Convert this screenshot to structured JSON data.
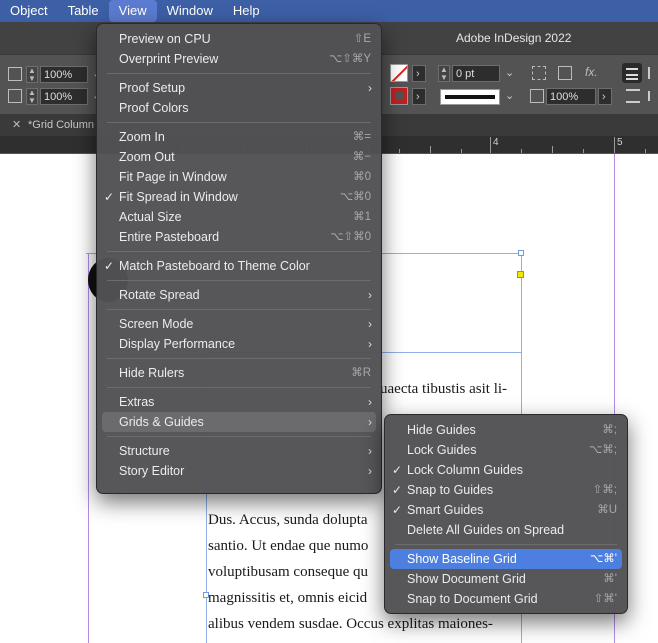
{
  "menubar": {
    "items": [
      "Object",
      "Table",
      "View",
      "Window",
      "Help"
    ]
  },
  "app": {
    "title": "Adobe InDesign 2022"
  },
  "controlbar": {
    "scale_x": "100%",
    "scale_y": "100%",
    "stroke_weight": "0 pt",
    "opacity": "100%",
    "fx_label": "fx."
  },
  "tabbar": {
    "tab_label": "*Grid Column I"
  },
  "ruler": {
    "labels": [
      "4",
      "5"
    ]
  },
  "document": {
    "lines_right": [
      "uaecta tibustis asit li-"
    ],
    "lines_main": [
      "Dus. Accus, sunda dolupta",
      "santio. Ut endae que numo",
      "voluptibusam conseque qu",
      "magnissitis et, omnis eicid",
      "alibus vendem susdae. Occus explitas maiones-"
    ]
  },
  "view_menu": {
    "items": [
      {
        "label": "Preview on CPU",
        "shortcut": "⇧E"
      },
      {
        "label": "Overprint Preview",
        "shortcut": "⌥⇧⌘Y"
      },
      {
        "label": "Proof Setup"
      },
      {
        "label": "Proof Colors"
      },
      {
        "label": "Zoom In",
        "shortcut": "⌘="
      },
      {
        "label": "Zoom Out",
        "shortcut": "⌘−"
      },
      {
        "label": "Fit Page in Window",
        "shortcut": "⌘0"
      },
      {
        "label": "Fit Spread in Window",
        "shortcut": "⌥⌘0"
      },
      {
        "label": "Actual Size",
        "shortcut": "⌘1"
      },
      {
        "label": "Entire Pasteboard",
        "shortcut": "⌥⇧⌘0"
      },
      {
        "label": "Match Pasteboard to Theme Color"
      },
      {
        "label": "Rotate Spread"
      },
      {
        "label": "Screen Mode"
      },
      {
        "label": "Display Performance"
      },
      {
        "label": "Hide Rulers",
        "shortcut": "⌘R"
      },
      {
        "label": "Extras"
      },
      {
        "label": "Grids & Guides"
      },
      {
        "label": "Structure"
      },
      {
        "label": "Story Editor"
      }
    ]
  },
  "grids_submenu": {
    "items": [
      {
        "label": "Hide Guides",
        "shortcut": "⌘;"
      },
      {
        "label": "Lock Guides",
        "shortcut": "⌥⌘;"
      },
      {
        "label": "Lock Column Guides"
      },
      {
        "label": "Snap to Guides",
        "shortcut": "⇧⌘;"
      },
      {
        "label": "Smart Guides",
        "shortcut": "⌘U"
      },
      {
        "label": "Delete All Guides on Spread"
      },
      {
        "label": "Show Baseline Grid",
        "shortcut": "⌥⌘'"
      },
      {
        "label": "Show Document Grid",
        "shortcut": "⌘'"
      },
      {
        "label": "Snap to Document Grid",
        "shortcut": "⇧⌘'"
      }
    ]
  },
  "colors": {
    "menubar_bg": "#3c5fa6",
    "highlight_blue": "#4d7fe0",
    "guide_purple": "#b58be6",
    "guide_blue": "#8fb1e8",
    "frame_handle_yellow": "#f2e600"
  }
}
